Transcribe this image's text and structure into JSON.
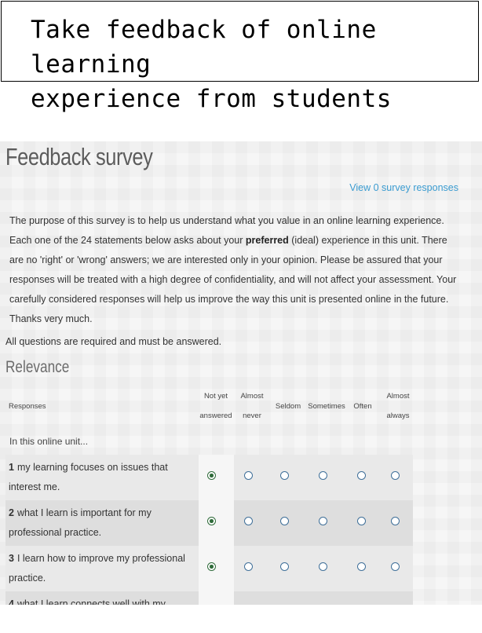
{
  "banner": {
    "text": "Take feedback of online learning\nexperience from students"
  },
  "page": {
    "title": "Feedback survey",
    "view_link": "View 0 survey responses",
    "intro": {
      "part1": "The purpose of this survey is to help us understand what you value in an online learning experience. Each one of the 24 statements below asks about your ",
      "bold": "preferred",
      "part2": " (ideal) experience in this unit. There are no 'right' or 'wrong' answers; we are interested only in your opinion. Please be assured that your responses will be treated with a high degree of confidentiality, and will not affect your assessment. Your carefully considered responses will help us improve the way this unit is presented online in the future. Thanks very much."
    },
    "required_note": "All questions are required and must be answered.",
    "section_title": "Relevance",
    "table": {
      "responses_header": "Responses",
      "columns": [
        "Not yet answered",
        "Almost never",
        "Seldom",
        "Sometimes",
        "Often",
        "Almost always"
      ],
      "col_not_yet_l1": "Not yet",
      "col_not_yet_l2": "answered",
      "col_almost_never_l1": "Almost",
      "col_almost_never_l2": "never",
      "col_seldom": "Seldom",
      "col_sometimes": "Sometimes",
      "col_often": "Often",
      "col_almost_always_l1": "Almost",
      "col_almost_always_l2": "always",
      "in_unit": "In this online unit...",
      "rows": [
        {
          "num": "1",
          "text": "my learning focuses on issues that interest me.",
          "selected": "Not yet answered"
        },
        {
          "num": "2",
          "text": "what I learn is important for my professional practice.",
          "selected": "Not yet answered"
        },
        {
          "num": "3",
          "text": "I learn how to improve my professional practice.",
          "selected": "Not yet answered"
        },
        {
          "num": "4",
          "text": "what I learn connects well with my",
          "selected": "Not yet answered"
        }
      ]
    }
  },
  "colors": {
    "link": "#3a9bd0",
    "title": "#5c5c5c",
    "row_odd": "#e9e9e9",
    "row_even": "#dedede",
    "radio_checked": "#2f6b3a"
  }
}
